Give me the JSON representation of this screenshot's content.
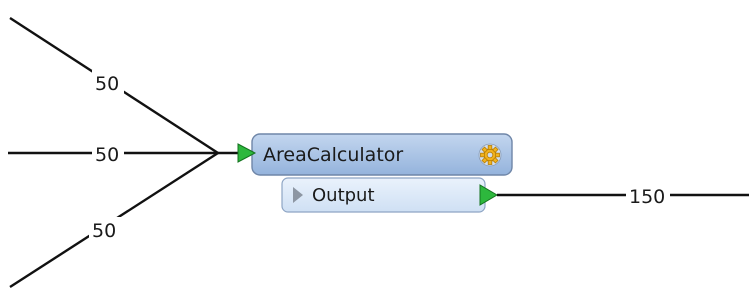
{
  "canvas": {
    "background": "#ffffff",
    "connection_color": "#111111"
  },
  "connections": {
    "input_top_count": "50",
    "input_middle_count": "50",
    "input_bottom_count": "50",
    "output_count": "150"
  },
  "transformer": {
    "name": "AreaCalculator",
    "settings_icon": "gear-icon",
    "header_color": "#a8c4e6",
    "output_port": {
      "label": "Output",
      "expand_icon": "triangle-right-icon",
      "fill_color": "#dce9f8"
    },
    "input_port_icon": "green-triangle-icon",
    "port_color": "#2db83d"
  }
}
